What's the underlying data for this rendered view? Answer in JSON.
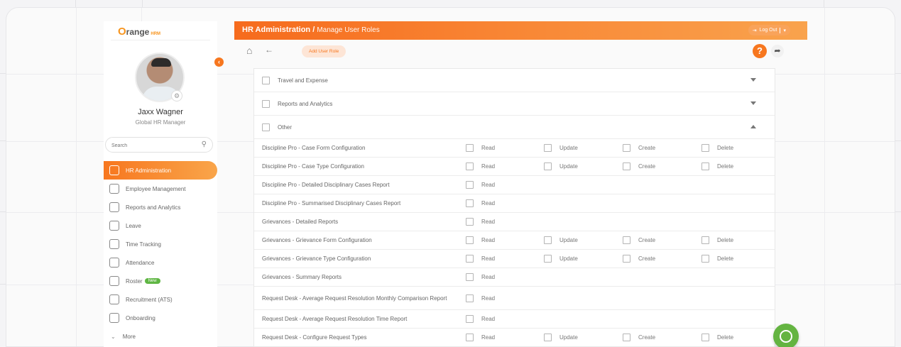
{
  "app": {
    "logo_first": "O",
    "logo_rest": "range",
    "logo_suffix": "HRM",
    "user_name": "Jaxx Wagner",
    "user_role": "Global HR Manager",
    "search_placeholder": "Search"
  },
  "sidebar": {
    "items": [
      {
        "label": "HR Administration",
        "active": true
      },
      {
        "label": "Employee Management"
      },
      {
        "label": "Reports and Analytics"
      },
      {
        "label": "Leave"
      },
      {
        "label": "Time Tracking"
      },
      {
        "label": "Attendance"
      },
      {
        "label": "Roster",
        "badge": "New"
      },
      {
        "label": "Recruitment (ATS)"
      },
      {
        "label": "Onboarding"
      },
      {
        "label": "More"
      }
    ]
  },
  "header": {
    "title": "HR Administration /",
    "subtitle": "Manage User Roles",
    "logout_label": "Log Out"
  },
  "toolbar": {
    "tab_label": "Add User Role",
    "help_label": "?"
  },
  "groups": [
    {
      "label": "Travel and Expense",
      "expanded": false
    },
    {
      "label": "Reports and Analytics",
      "expanded": false
    },
    {
      "label": "Other",
      "expanded": true
    }
  ],
  "permission_labels": {
    "read": "Read",
    "update": "Update",
    "create": "Create",
    "delete": "Delete"
  },
  "permissions": [
    {
      "name": "Discipline Pro - Case Form Configuration",
      "full": true
    },
    {
      "name": "Discipline Pro - Case Type Configuration",
      "full": true
    },
    {
      "name": "Discipline Pro - Detailed Disciplinary Cases Report",
      "full": false
    },
    {
      "name": "Discipline Pro - Summarised Disciplinary Cases Report",
      "full": false
    },
    {
      "name": "Grievances - Detailed Reports",
      "full": false
    },
    {
      "name": "Grievances - Grievance Form Configuration",
      "full": true
    },
    {
      "name": "Grievances - Grievance Type Configuration",
      "full": true
    },
    {
      "name": "Grievances - Summary Reports",
      "full": false
    },
    {
      "name": "Request Desk - Average Request Resolution Monthly Comparison Report",
      "full": false
    },
    {
      "name": "Request Desk - Average Request Resolution Time Report",
      "full": false
    },
    {
      "name": "Request Desk - Configure Request Types",
      "full": true
    }
  ]
}
